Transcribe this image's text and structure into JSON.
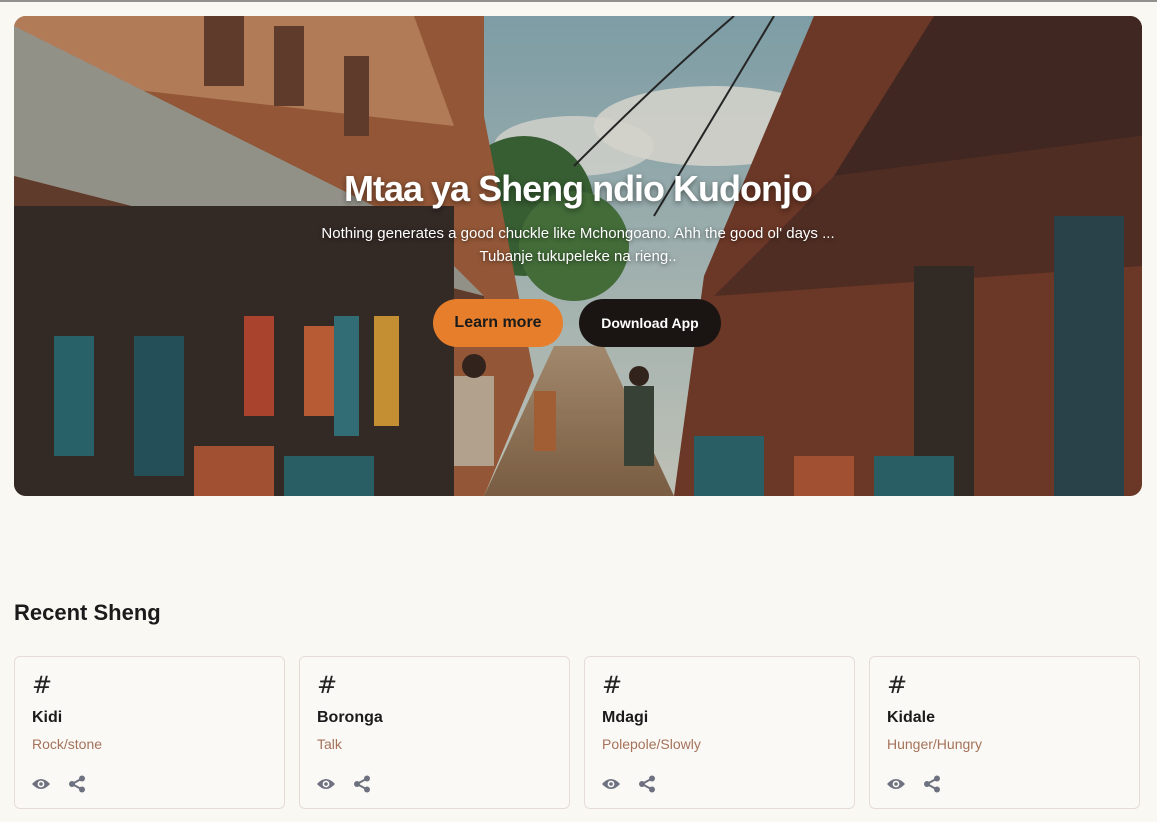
{
  "hero": {
    "title": "Mtaa ya Sheng ndio Kudonjo",
    "subtitle_line1": "Nothing generates a good chuckle like Mchongoano. Ahh the good ol' days ...",
    "subtitle_line2": "Tubanje tukupeleke na rieng..",
    "learn_more_label": "Learn more",
    "download_label": "Download App"
  },
  "recent": {
    "title": "Recent Sheng",
    "cards": [
      {
        "hash": "#",
        "word": "Kidi",
        "meaning": "Rock/stone"
      },
      {
        "hash": "#",
        "word": "Boronga",
        "meaning": "Talk"
      },
      {
        "hash": "#",
        "word": "Mdagi",
        "meaning": "Polepole/Slowly"
      },
      {
        "hash": "#",
        "word": "Kidale",
        "meaning": "Hunger/Hungry"
      }
    ]
  },
  "icons": {
    "view": "eye-icon",
    "share": "share-icon"
  },
  "colors": {
    "accent": "#e67e2b",
    "dark_button": "#1a1512",
    "meaning_text": "#a5725a",
    "background": "#faf8f3",
    "icon": "#6e7280"
  }
}
